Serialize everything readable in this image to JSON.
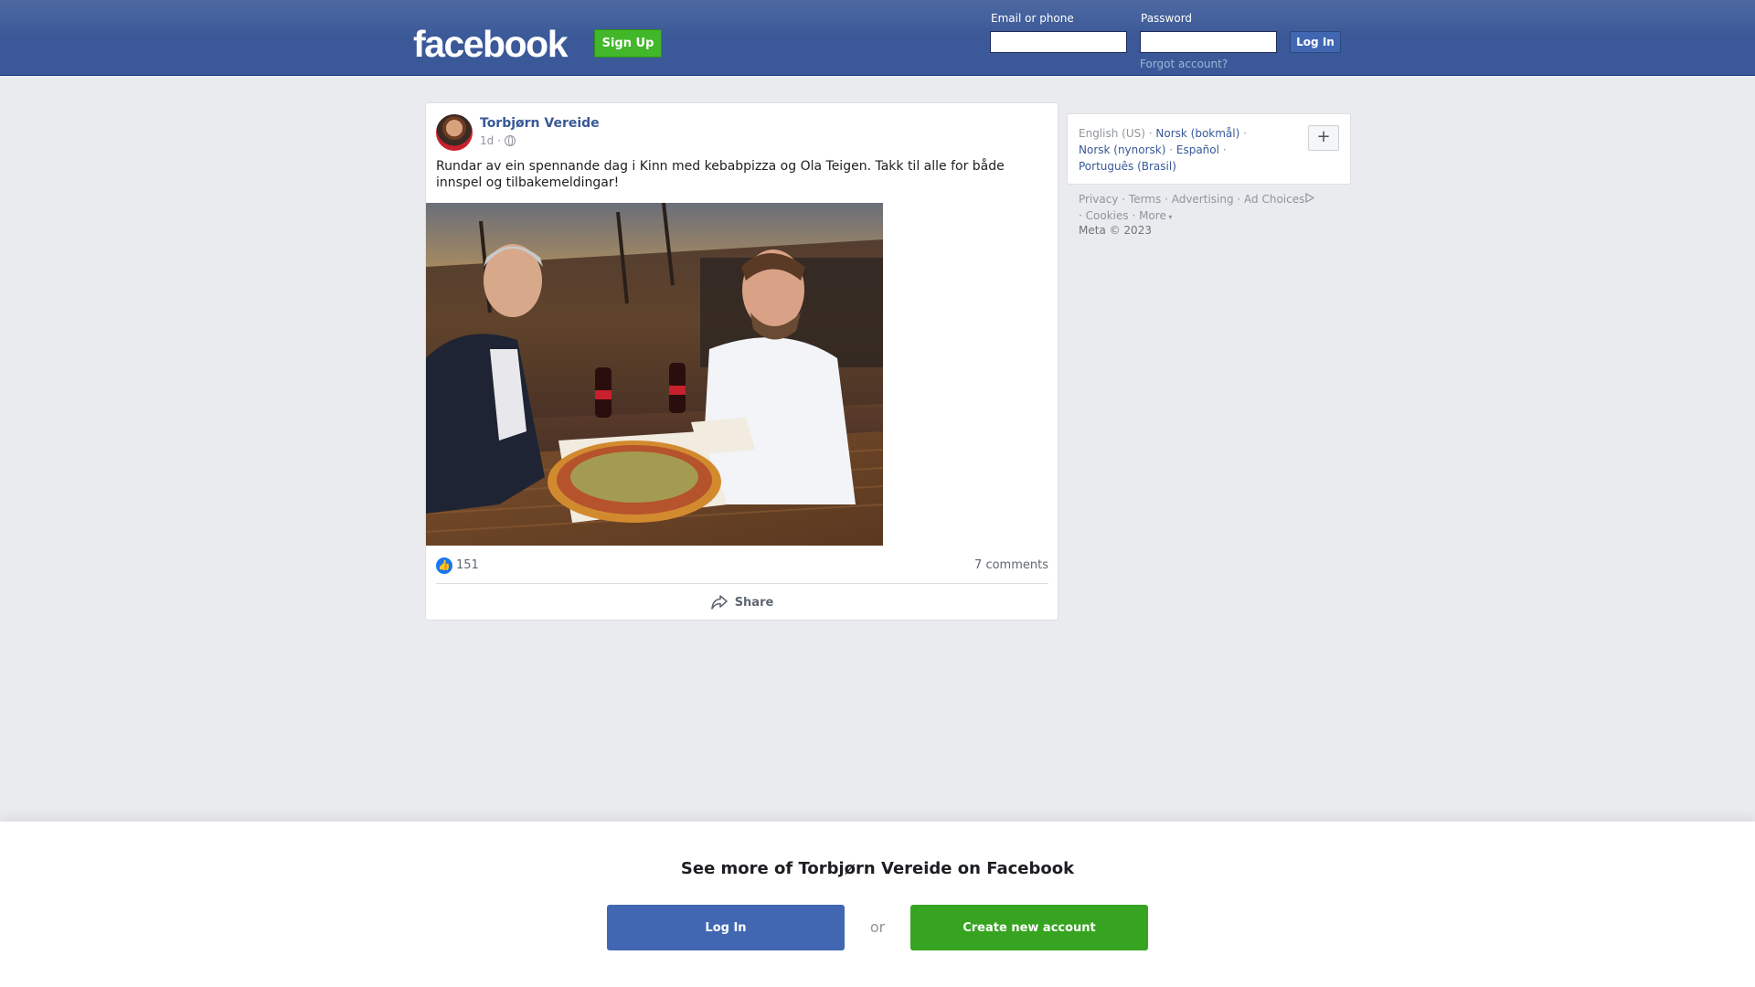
{
  "header": {
    "logo": "facebook",
    "signup_label": "Sign Up",
    "email_label": "Email or phone",
    "password_label": "Password",
    "email_value": "",
    "password_value": "",
    "login_label": "Log In",
    "forgot_label": "Forgot account?"
  },
  "post": {
    "author": "Torbjørn Vereide",
    "time": "1d",
    "separator": "·",
    "text": "Rundar av ein spennande dag i Kinn med kebabpizza og Ola Teigen. Takk til alle for både innspel og tilbakemeldingar!",
    "like_count": "151",
    "comments": "7 comments",
    "share_label": "Share"
  },
  "sidebar": {
    "languages": {
      "current": "English (US)",
      "options": [
        "Norsk (bokmål)",
        "Norsk (nynorsk)",
        "Español",
        "Português (Brasil)"
      ],
      "more_label": "+"
    },
    "footer_links": [
      "Privacy",
      "Terms",
      "Advertising",
      "Ad Choices",
      "Cookies",
      "More"
    ],
    "copyright": "Meta © 2023"
  },
  "banner": {
    "title": "See more of Torbjørn Vereide on Facebook",
    "login_label": "Log In",
    "or_label": "or",
    "create_label": "Create new account"
  },
  "colors": {
    "brand_blue": "#3b5998",
    "link_blue": "#385898",
    "green": "#42b72a"
  }
}
